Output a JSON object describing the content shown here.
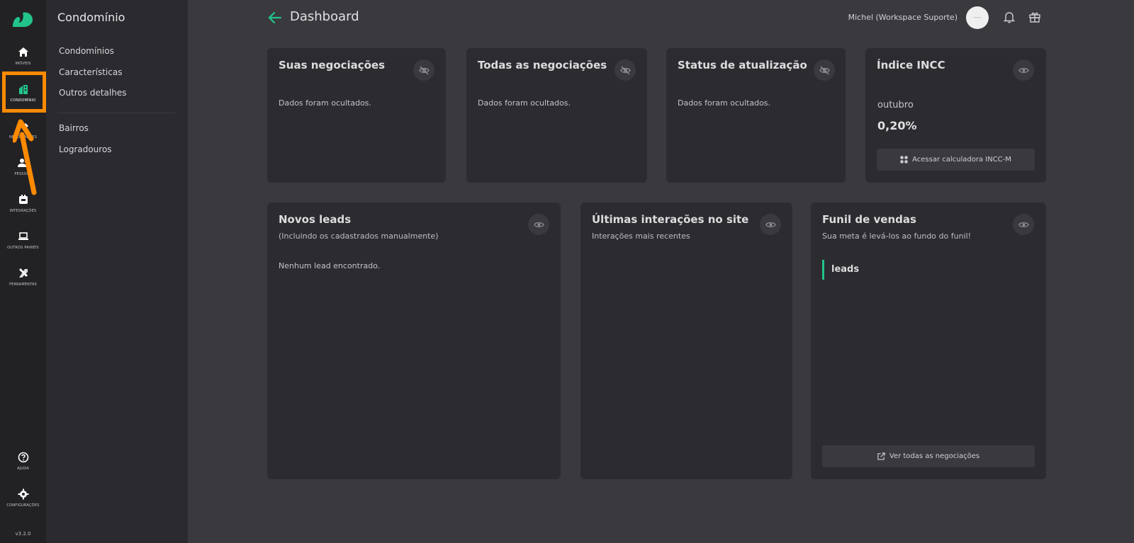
{
  "colors": {
    "accent": "#22c48a",
    "highlight": "#ff8a00",
    "rail_bg": "#222225",
    "subnav_bg": "#2b2a2f",
    "main_bg": "#3a393e",
    "card_bg": "#2c2b30"
  },
  "rail": {
    "logo": "squirrel-logo",
    "items": [
      {
        "label": "Imóveis",
        "icon": "home-icon"
      },
      {
        "label": "Condomínio",
        "icon": "building-icon",
        "active": true
      },
      {
        "label": "Negociações",
        "icon": "handshake-icon"
      },
      {
        "label": "Pessoas",
        "icon": "people-icon"
      },
      {
        "label": "Integrações",
        "icon": "plug-icon"
      },
      {
        "label": "Outros painéis",
        "icon": "laptop-icon"
      },
      {
        "label": "Ferramentas",
        "icon": "tools-icon"
      },
      {
        "label": "Ajuda",
        "icon": "help-icon"
      },
      {
        "label": "Configurações",
        "icon": "gear-icon"
      }
    ],
    "version": "v3.2.0"
  },
  "subnav": {
    "title": "Condomínio",
    "items": [
      "Condomínios",
      "Características",
      "Outros detalhes",
      "Bairros",
      "Logradouros"
    ]
  },
  "header": {
    "title": "Dashboard",
    "user": "Michel (Workspace Suporte)",
    "avatar_text": "---"
  },
  "cards": {
    "suas": {
      "title": "Suas negociações",
      "message": "Dados foram ocultados."
    },
    "todas": {
      "title": "Todas as negociações",
      "message": "Dados foram ocultados."
    },
    "status": {
      "title": "Status de atualização",
      "message": "Dados foram ocultados."
    },
    "incc": {
      "title": "Índice INCC",
      "month": "outubro",
      "value": "0,20%",
      "button": "Acessar calculadora INCC-M"
    },
    "leads": {
      "title": "Novos leads",
      "subtitle": "(Incluindo os cadastrados manualmente)",
      "message": "Nenhum lead encontrado."
    },
    "interacoes": {
      "title": "Últimas interações no site",
      "subtitle": "Interações mais recentes"
    },
    "funil": {
      "title": "Funil de vendas",
      "subtitle": "Sua meta é levá-los ao fundo do funil!",
      "stage": "leads",
      "button": "Ver todas as negociações"
    }
  }
}
